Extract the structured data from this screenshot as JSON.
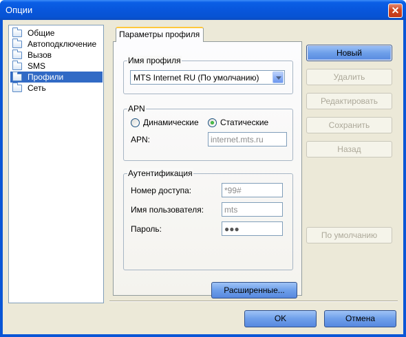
{
  "window": {
    "title": "Опции"
  },
  "tree": {
    "items": [
      {
        "label": "Общие",
        "selected": false
      },
      {
        "label": "Автоподключение",
        "selected": false
      },
      {
        "label": "Вызов",
        "selected": false
      },
      {
        "label": "SMS",
        "selected": false
      },
      {
        "label": "Профили",
        "selected": true
      },
      {
        "label": "Сеть",
        "selected": false
      }
    ]
  },
  "tab": {
    "label": "Параметры профиля"
  },
  "profile_name": {
    "group_title": "Имя профиля",
    "selected": "MTS Internet RU (По умолчанию)"
  },
  "apn": {
    "group_title": "APN",
    "radio_dynamic": "Динамические",
    "radio_static": "Статические",
    "selected_mode": "Статические",
    "field_label": "APN:",
    "field_value": "internet.mts.ru"
  },
  "auth": {
    "group_title": "Аутентификация",
    "number_label": "Номер доступа:",
    "number_value": "*99#",
    "user_label": "Имя пользователя:",
    "user_value": "mts",
    "password_label": "Пароль:",
    "password_value": "●●●"
  },
  "buttons": {
    "advanced": "Расширенные...",
    "new": "Новый",
    "delete": "Удалить",
    "edit": "Редактировать",
    "save": "Сохранить",
    "back": "Назад",
    "default": "По умолчанию",
    "ok": "OK",
    "cancel": "Отмена"
  },
  "icons": {
    "close": "close-icon",
    "folder": "folder-icon",
    "dropdown": "chevron-down-icon"
  },
  "colors": {
    "titlebar": "#0856dc",
    "selection": "#316ac5",
    "dialog_bg": "#ece9d8"
  }
}
